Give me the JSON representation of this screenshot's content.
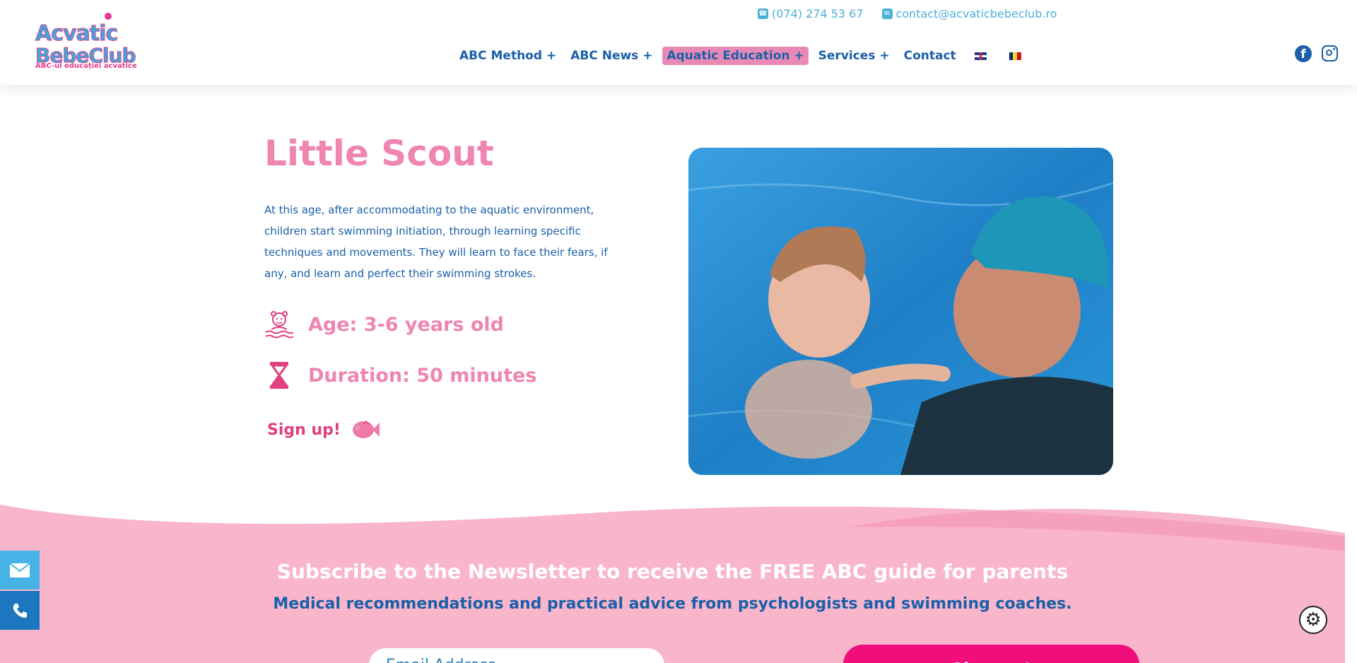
{
  "header": {
    "logo": {
      "line1": "Acvatic",
      "line2": "BebeClub",
      "subtitle": "ABC-ul educației acvatice"
    },
    "contact": {
      "phone": "(074) 274 53 67",
      "email": "contact@acvaticbebeclub.ro"
    },
    "nav": [
      {
        "label": "ABC Method +"
      },
      {
        "label": "ABC News +"
      },
      {
        "label": "Aquatic Education +",
        "active": true
      },
      {
        "label": "Services +"
      },
      {
        "label": "Contact"
      }
    ],
    "languages": [
      "en-flag-icon",
      "ro-flag-icon"
    ],
    "social": [
      "facebook-icon",
      "instagram-icon"
    ]
  },
  "main": {
    "title": "Little Scout",
    "description": "At this age, after accommodating to the aquatic environment, children start swimming initiation, through learning specific techniques and movements. They will learn to face their fears, if any, and learn and perfect their swimming strokes.",
    "age": "Age: 3-6 years old",
    "duration": "Duration: 50 minutes",
    "signup": "Sign up!"
  },
  "newsletter": {
    "title": "Subscribe to the Newsletter to receive the FREE ABC guide for parents",
    "subtitle": "Medical recommendations and practical advice from psychologists and swimming coaches.",
    "email_placeholder": "Email Address",
    "button": "Sign up!"
  },
  "colors": {
    "primary_blue": "#1a5fa8",
    "light_blue": "#4cb0d8",
    "pink": "#ee86b1",
    "hot_pink": "#ef0e7b",
    "wave_pink": "#f9b6cb"
  }
}
